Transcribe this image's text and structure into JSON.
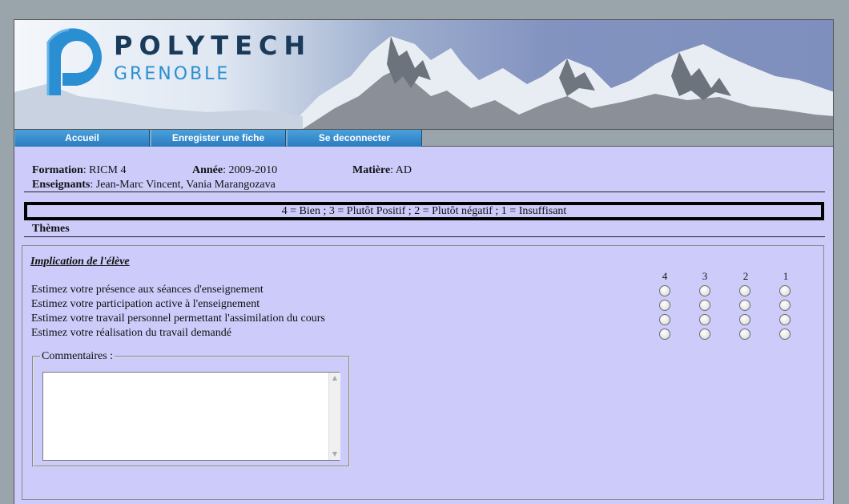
{
  "brand": {
    "name": "POLYTECH",
    "subname": "GRENOBLE",
    "primary_color": "#1a3a5a",
    "accent_color": "#2a8fd2"
  },
  "nav": {
    "items": [
      {
        "label": "Accueil"
      },
      {
        "label": "Enregister une fiche"
      },
      {
        "label": "Se deconnecter"
      }
    ]
  },
  "info": {
    "formation_label": "Formation",
    "formation_value": ": RICM 4",
    "annee_label": "Année",
    "annee_value": ": 2009-2010",
    "matiere_label": "Matière",
    "matiere_value": ": AD",
    "enseignants_label": "Enseignants",
    "enseignants_value": ": Jean-Marc Vincent, Vania Marangozava"
  },
  "legend": "4 = Bien ; 3 = Plutôt Positif ; 2 = Plutôt négatif ; 1 = Insuffisant",
  "themes_label": "Thèmes",
  "section": {
    "title": "Implication de l'élève",
    "scale": [
      "4",
      "3",
      "2",
      "1"
    ],
    "questions": [
      "Estimez votre présence aux séances d'enseignement",
      "Estimez votre participation active à l'enseignement",
      "Estimez votre travail personnel permettant l'assimilation du cours",
      "Estimez votre réalisation du travail demandé"
    ],
    "comments_legend": "Commentaires :",
    "comments_value": ""
  },
  "icons": {
    "logo": "polytech-logo-icon",
    "scroll_up": "scroll-up-arrow-icon",
    "scroll_down": "scroll-down-arrow-icon"
  },
  "colors": {
    "page_bg": "#cccbfa",
    "nav_button": "#2a7bbf",
    "outer_bg": "#9aa5ab"
  }
}
